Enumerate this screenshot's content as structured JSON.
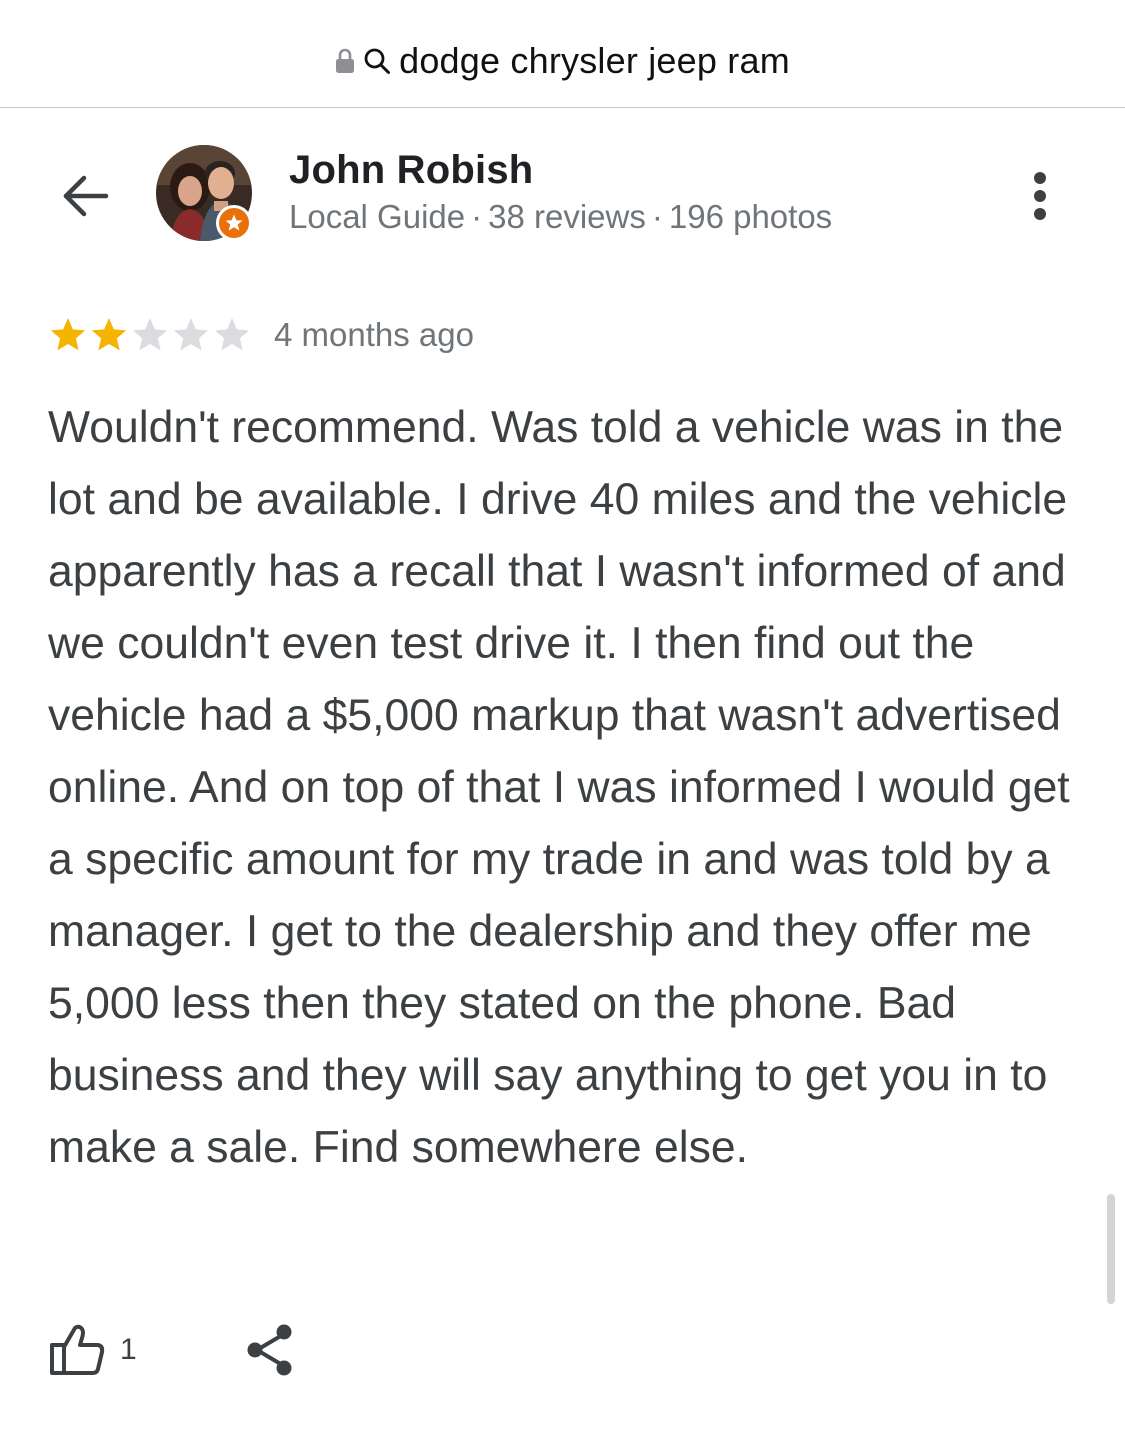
{
  "url_bar": {
    "text": "dodge chrysler jeep ram",
    "lock_icon": "lock-icon",
    "search_icon": "search-icon"
  },
  "header": {
    "back_icon": "arrow-back-icon",
    "more_icon": "more-vertical-icon"
  },
  "reviewer": {
    "name": "John Robish",
    "level": "Local Guide",
    "reviews": "38 reviews",
    "photos": "196 photos",
    "separator": "·",
    "badge_color": "#e8710a"
  },
  "review": {
    "rating": 2,
    "max_rating": 5,
    "date": "4 months ago",
    "text": "Wouldn't recommend. Was told a vehicle was in the lot and be available. I drive 40 miles and the vehicle apparently has a recall that I wasn't informed of and we couldn't even test drive it. I then find out the vehicle had a $5,000 markup that wasn't advertised online. And on top of that I was informed I would get a specific amount for my trade in and was told by a manager. I get to the dealership and they offer me 5,000 less then they stated on the phone. Bad business and they will say anything to get you in to make a sale. Find somewhere else."
  },
  "actions": {
    "like_count": "1",
    "like_icon": "thumbs-up-icon",
    "share_icon": "share-icon"
  },
  "colors": {
    "star_filled": "#f5b400",
    "star_empty": "#dadce0",
    "secondary_text": "#70757a",
    "body_text": "#3c4043"
  }
}
